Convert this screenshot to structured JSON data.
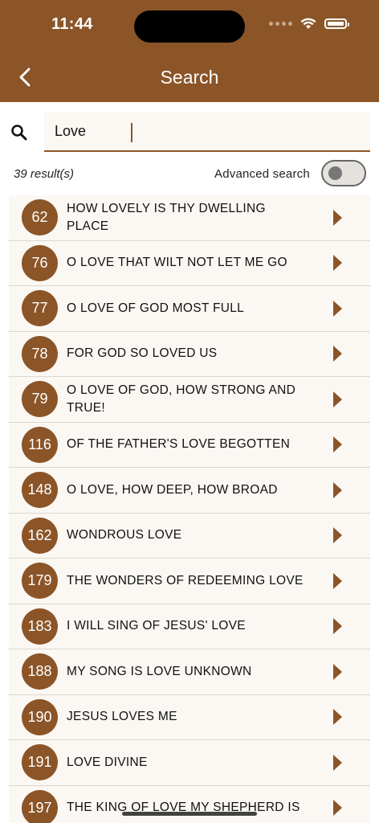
{
  "status_bar": {
    "time": "11:44"
  },
  "header": {
    "title": "Search"
  },
  "search": {
    "value": "Love",
    "placeholder": ""
  },
  "results": {
    "count_text": "39 result(s)",
    "advanced_label": "Advanced search",
    "advanced_enabled": false
  },
  "colors": {
    "accent": "#8b5528",
    "list_bg": "#fbf8f4"
  },
  "items": [
    {
      "number": "62",
      "title": "HOW LOVELY IS THY DWELLING PLACE"
    },
    {
      "number": "76",
      "title": "O LOVE THAT WILT NOT LET ME GO"
    },
    {
      "number": "77",
      "title": "O LOVE OF GOD MOST FULL"
    },
    {
      "number": "78",
      "title": "FOR GOD SO LOVED US"
    },
    {
      "number": "79",
      "title": "O LOVE OF GOD, HOW STRONG AND TRUE!"
    },
    {
      "number": "116",
      "title": "OF THE FATHER'S LOVE BEGOTTEN"
    },
    {
      "number": "148",
      "title": "O LOVE, HOW DEEP, HOW BROAD"
    },
    {
      "number": "162",
      "title": "WONDROUS LOVE"
    },
    {
      "number": "179",
      "title": "THE WONDERS OF REDEEMING LOVE"
    },
    {
      "number": "183",
      "title": "I WILL SING OF JESUS' LOVE"
    },
    {
      "number": "188",
      "title": "MY SONG IS LOVE UNKNOWN"
    },
    {
      "number": "190",
      "title": "JESUS LOVES ME"
    },
    {
      "number": "191",
      "title": "LOVE DIVINE"
    },
    {
      "number": "197",
      "title": "THE KING OF LOVE MY SHEPHERD IS"
    }
  ]
}
